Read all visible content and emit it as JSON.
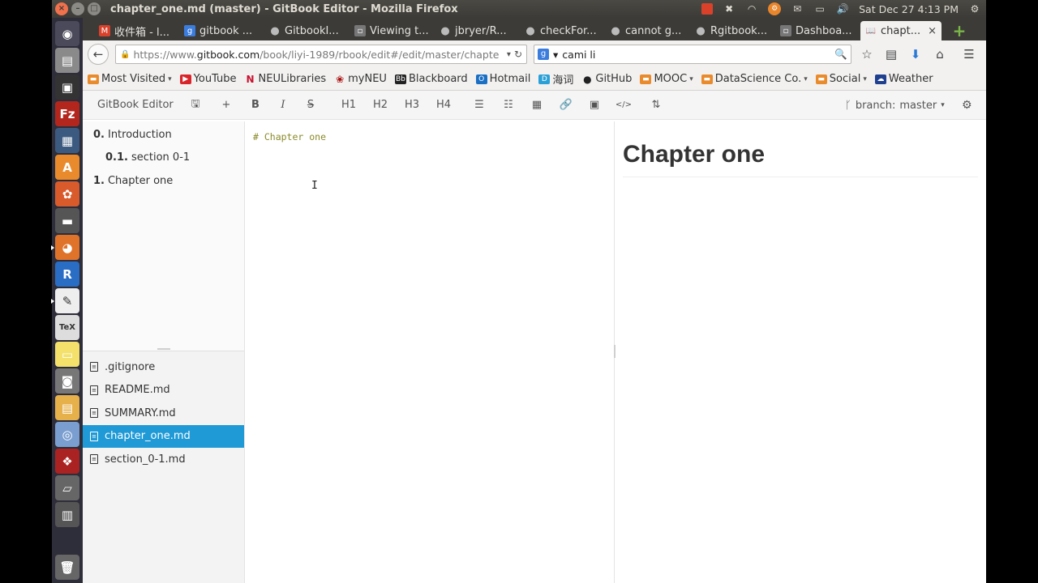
{
  "panel": {
    "window_title": "chapter_one.md (master) - GitBook Editor - Mozilla Firefox",
    "clock": "Sat Dec 27  4:13 PM"
  },
  "launcher": [
    "ubuntu-dash-icon",
    "files-icon",
    "terminal-icon",
    "filezilla-icon",
    "remote-desktop-icon",
    "software-center-icon",
    "settings-icon",
    "workspace-icon",
    "firefox-icon",
    "r-icon",
    "text-editor-icon",
    "tex-icon",
    "sticky-notes-icon",
    "screenshot-icon",
    "document-viewer-icon",
    "disk-icon",
    "app-icon",
    "scanner-icon",
    "book-icon"
  ],
  "tabs": [
    {
      "label": "收件箱 - l...",
      "icon": "gmail-icon",
      "color": "#d9412b"
    },
    {
      "label": "gitbook ...",
      "icon": "google-icon",
      "color": "#3b7ddd"
    },
    {
      "label": "GitbookI...",
      "icon": "github-icon",
      "color": "#444"
    },
    {
      "label": "Viewing t...",
      "icon": "page-icon",
      "color": "#777"
    },
    {
      "label": "jbryer/R...",
      "icon": "github-icon",
      "color": "#444"
    },
    {
      "label": "checkFor...",
      "icon": "github-icon",
      "color": "#444"
    },
    {
      "label": "cannot g...",
      "icon": "github-icon",
      "color": "#444"
    },
    {
      "label": "Rgitbook...",
      "icon": "github-icon",
      "color": "#444"
    },
    {
      "label": "Dashboa...",
      "icon": "page-icon",
      "color": "#777"
    }
  ],
  "active_tab": {
    "label": "chapt...",
    "icon": "book-icon"
  },
  "nav": {
    "url_prefix": "https://www.",
    "url_host": "gitbook.com",
    "url_path": "/book/liyi-1989/rbook/edit#/edit/master/chapte",
    "search_value": "cami li"
  },
  "bookmarks": [
    {
      "label": "Most Visited",
      "icon": "folder-icon",
      "color": "#e98b2c",
      "caret": true
    },
    {
      "label": "YouTube",
      "icon": "youtube-icon",
      "color": "#d9252a",
      "caret": false
    },
    {
      "label": "NEULibraries",
      "icon": "neu-icon",
      "color": "#c8102e",
      "caret": false
    },
    {
      "label": "myNEU",
      "icon": "paw-icon",
      "color": "#a11",
      "caret": false
    },
    {
      "label": "Blackboard",
      "icon": "blackboard-icon",
      "color": "#222",
      "caret": false
    },
    {
      "label": "Hotmail",
      "icon": "outlook-icon",
      "color": "#1a6fc4",
      "caret": false
    },
    {
      "label": "海词",
      "icon": "dict-icon",
      "color": "#2aa0d6",
      "caret": false
    },
    {
      "label": "GitHub",
      "icon": "github-icon",
      "color": "#222",
      "caret": false
    },
    {
      "label": "MOOC",
      "icon": "folder-icon",
      "color": "#e98b2c",
      "caret": true
    },
    {
      "label": "DataScience Co.",
      "icon": "folder-icon",
      "color": "#e98b2c",
      "caret": true
    },
    {
      "label": "Social",
      "icon": "folder-icon",
      "color": "#e98b2c",
      "caret": true
    },
    {
      "label": "Weather",
      "icon": "weather-icon",
      "color": "#1f3f8f",
      "caret": false
    }
  ],
  "gitbook": {
    "brand": "GitBook Editor",
    "tools": [
      {
        "name": "save-icon",
        "glyph": "🖫"
      },
      {
        "name": "add-icon",
        "glyph": "+"
      },
      {
        "name": "bold-button",
        "glyph": "B"
      },
      {
        "name": "italic-button",
        "glyph": "I"
      },
      {
        "name": "strikethrough-button",
        "glyph": "S"
      },
      {
        "name": "h1-button",
        "glyph": "H1"
      },
      {
        "name": "h2-button",
        "glyph": "H2"
      },
      {
        "name": "h3-button",
        "glyph": "H3"
      },
      {
        "name": "h4-button",
        "glyph": "H4"
      },
      {
        "name": "bullet-list-icon",
        "glyph": "☰"
      },
      {
        "name": "numbered-list-icon",
        "glyph": "☷"
      },
      {
        "name": "table-icon",
        "glyph": "▦"
      },
      {
        "name": "link-icon",
        "glyph": "🔗"
      },
      {
        "name": "image-icon",
        "glyph": "▣"
      },
      {
        "name": "code-icon",
        "glyph": "</>"
      },
      {
        "name": "sort-icon",
        "glyph": "⇅"
      }
    ],
    "branch_label": "branch:",
    "branch_value": "master"
  },
  "summary": [
    {
      "num": "0.",
      "label": "Introduction",
      "indent": 0
    },
    {
      "num": "0.1.",
      "label": "section 0-1",
      "indent": 1
    },
    {
      "num": "1.",
      "label": "Chapter one",
      "indent": 0
    }
  ],
  "files": [
    {
      "label": ".gitignore",
      "selected": false
    },
    {
      "label": "README.md",
      "selected": false
    },
    {
      "label": "SUMMARY.md",
      "selected": false
    },
    {
      "label": "chapter_one.md",
      "selected": true
    },
    {
      "label": "section_0-1.md",
      "selected": false
    }
  ],
  "editor": {
    "content": "# Chapter one",
    "cursor": "I"
  },
  "preview": {
    "heading": "Chapter one"
  }
}
